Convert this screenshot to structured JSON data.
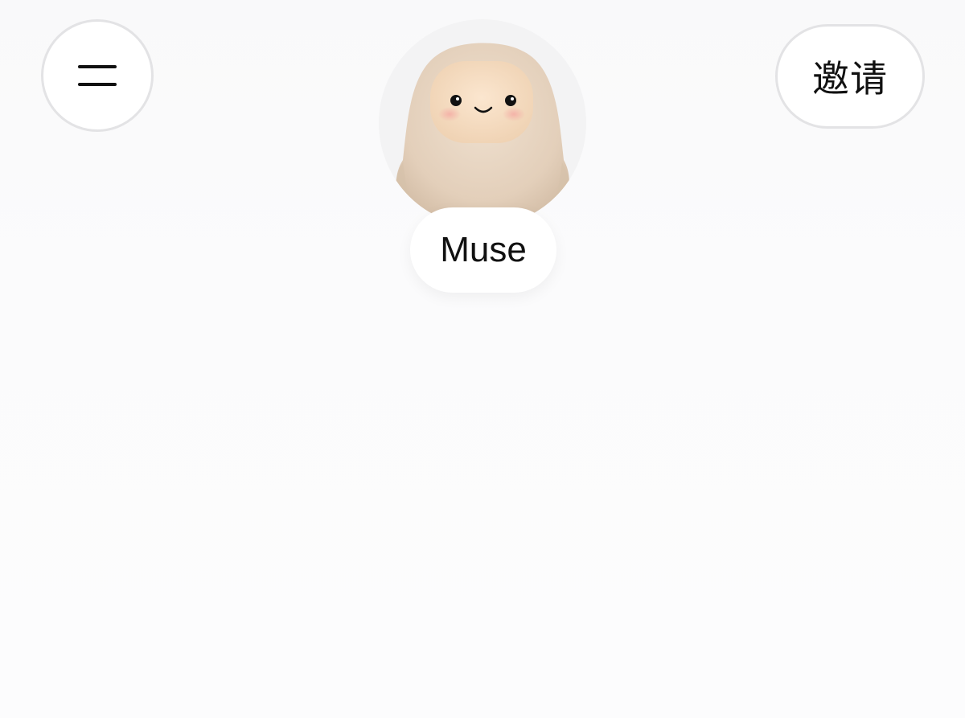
{
  "header": {
    "menu_icon": "hamburger-menu-icon",
    "invite_label": "邀请"
  },
  "assistant": {
    "name": "Muse",
    "avatar_icon": "fluffy-mascot-avatar"
  },
  "colors": {
    "background": "#fcfcfd",
    "button_border": "#e3e3e5",
    "text": "#111111",
    "mascot_fur": "#e6d3c0",
    "mascot_face": "#f6dcc0"
  }
}
